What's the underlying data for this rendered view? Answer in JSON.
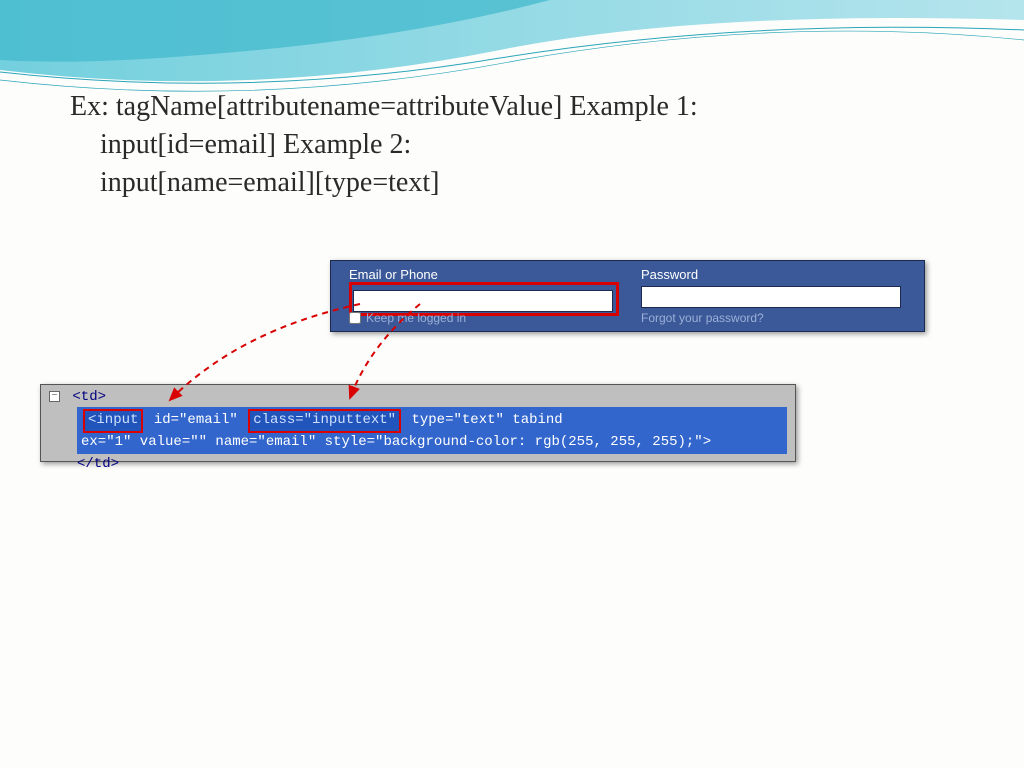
{
  "text": {
    "line1": "Ex: tagName[attributename=attributeValue] Example 1:",
    "line2": "input[id=email] Example 2:",
    "line3": "input[name=email][type=text]"
  },
  "fb": {
    "email_label": "Email or Phone",
    "password_label": "Password",
    "keep_logged": "Keep me logged in",
    "forgot": "Forgot your password?"
  },
  "code": {
    "td_open": "<td>",
    "hl1": "<input",
    "seg_id": " id=\"email\" ",
    "hl2": "class=\"inputtext\"",
    "seg_rest1": " type=\"text\" tabind",
    "seg_rest2": "ex=\"1\" value=\"\" name=\"email\" style=\"background-color: rgb(255, 255, 255);\">",
    "td_close": "</td>"
  }
}
